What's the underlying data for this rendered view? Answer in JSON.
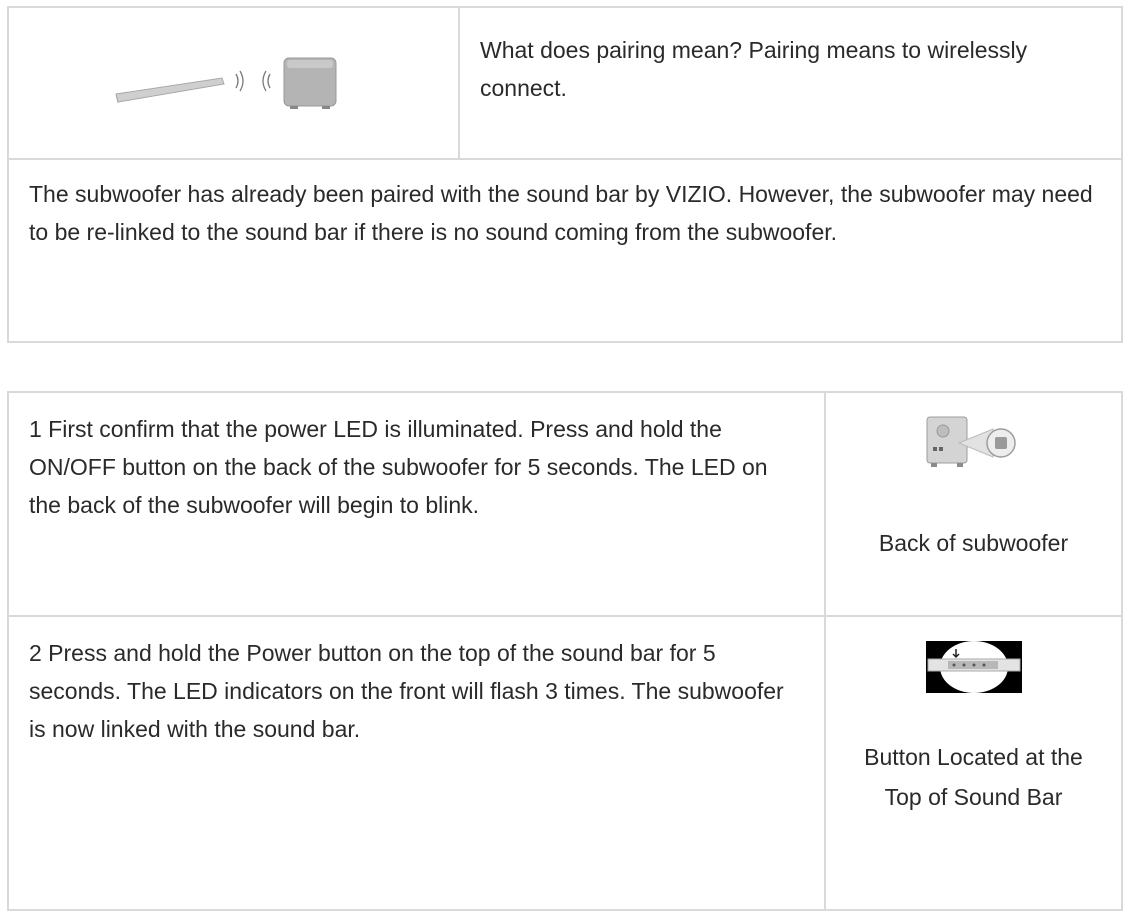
{
  "intro_table": {
    "pairing_question": "What does pairing mean? Pairing means to wirelessly connect.",
    "pairing_image_icon": "soundbar-subwoofer-wireless-image",
    "note": "The subwoofer has already been paired with the sound bar by VIZIO. However, the subwoofer may need to be re-linked to the sound bar if there is no sound coming from the subwoofer."
  },
  "steps_table": {
    "steps": [
      {
        "text": "1 First confirm that the power LED is illuminated. Press and hold the ON/OFF button on the back of the subwoofer for 5 seconds. The LED on the back of the subwoofer will begin to blink.",
        "image_icon": "subwoofer-back-image",
        "caption": "Back of subwoofer"
      },
      {
        "text": "2 Press and hold the Power button on the top of the sound bar for 5 seconds. The LED indicators on the front will flash 3 times. The subwoofer is now linked with the sound bar.",
        "image_icon": "soundbar-top-button-image",
        "caption": "Button Located at the Top of Sound Bar"
      }
    ]
  }
}
